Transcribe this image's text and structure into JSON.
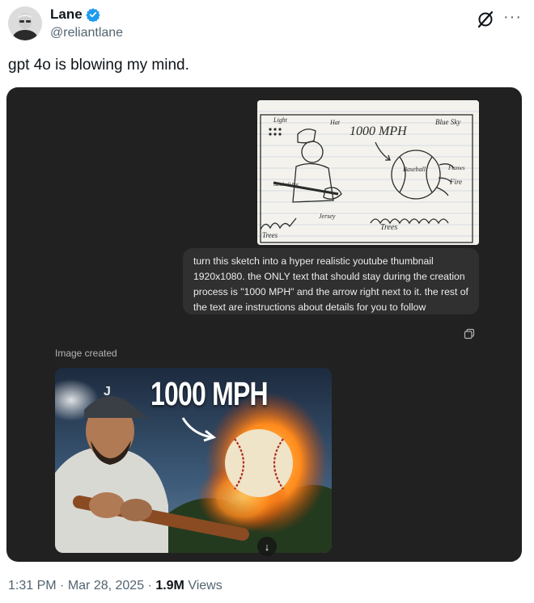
{
  "author": {
    "name": "Lane",
    "handle": "@reliantlane"
  },
  "tweet": {
    "text": "gpt 4o is blowing my mind."
  },
  "chat": {
    "sketch": {
      "texts": [
        "Light",
        "Hat",
        "1000 MPH",
        "Blue Sky",
        "Baseball",
        "Flames",
        "Fire",
        "Baseball Bat",
        "Jersey",
        "Trees",
        "Trees"
      ]
    },
    "user_message_lines": [
      "turn this sketch into a hyper realistic youtube thumbnail",
      "1920x1080. the ONLY text that should stay during the creation",
      "process is \"1000 MPH\" and the arrow right next to it. the rest of",
      "the text are instructions about details for you to follow"
    ],
    "image_created_label": "Image created",
    "generated_image": {
      "headline": "1000 MPH",
      "cap_letter": "J"
    }
  },
  "footer": {
    "time": "1:31 PM",
    "sep1": " · ",
    "date": "Mar 28, 2025",
    "sep2": " · ",
    "views": "1.9M",
    "views_label": " Views"
  },
  "colors": {
    "card_bg": "#212121",
    "bubble_bg": "#303030",
    "verified_blue": "#1d9bf0"
  },
  "icons": [
    "avatar",
    "verified-badge-icon",
    "grok-icon",
    "more-icon",
    "copy-icon",
    "download-arrow-icon"
  ]
}
